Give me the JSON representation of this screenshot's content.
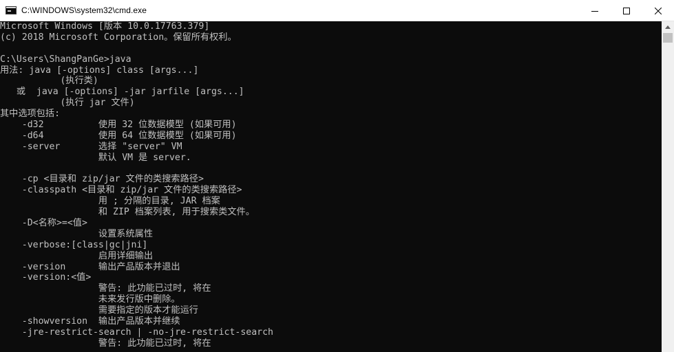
{
  "window": {
    "title": "C:\\WINDOWS\\system32\\cmd.exe",
    "icons": {
      "app": "console-icon",
      "minimize": "minimize-icon",
      "maximize": "maximize-icon",
      "close": "close-icon"
    }
  },
  "console": {
    "lines": [
      "Microsoft Windows [版本 10.0.17763.379]",
      "(c) 2018 Microsoft Corporation。保留所有权利。",
      "",
      "C:\\Users\\ShangPanGe>java",
      "用法: java [-options] class [args...]",
      "           (执行类)",
      "   或  java [-options] -jar jarfile [args...]",
      "           (执行 jar 文件)",
      "其中选项包括:",
      "    -d32          使用 32 位数据模型 (如果可用)",
      "    -d64          使用 64 位数据模型 (如果可用)",
      "    -server       选择 \"server\" VM",
      "                  默认 VM 是 server.",
      "",
      "    -cp <目录和 zip/jar 文件的类搜索路径>",
      "    -classpath <目录和 zip/jar 文件的类搜索路径>",
      "                  用 ; 分隔的目录, JAR 档案",
      "                  和 ZIP 档案列表, 用于搜索类文件。",
      "    -D<名称>=<值>",
      "                  设置系统属性",
      "    -verbose:[class|gc|jni]",
      "                  启用详细输出",
      "    -version      输出产品版本并退出",
      "    -version:<值>",
      "                  警告: 此功能已过时, 将在",
      "                  未来发行版中删除。",
      "                  需要指定的版本才能运行",
      "    -showversion  输出产品版本并继续",
      "    -jre-restrict-search | -no-jre-restrict-search",
      "                  警告: 此功能已过时, 将在"
    ]
  },
  "scrollbar": {
    "up_icon": "chevron-up-icon"
  },
  "colors": {
    "console_bg": "#0c0c0c",
    "console_fg": "#c0c0c0",
    "titlebar_bg": "#ffffff",
    "scrollbar_bg": "#f0f0f0",
    "thumb": "#c1c1c1"
  }
}
